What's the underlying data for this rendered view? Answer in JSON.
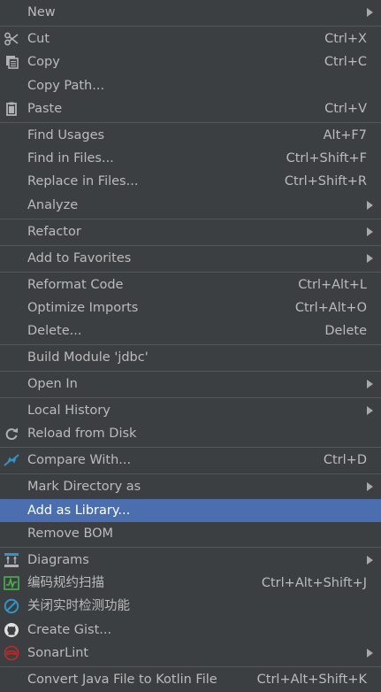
{
  "menu": {
    "new": {
      "label": "New"
    },
    "cut": {
      "label": "Cut",
      "shortcut": "Ctrl+X",
      "icon": "scissors-icon"
    },
    "copy": {
      "label": "Copy",
      "shortcut": "Ctrl+C",
      "icon": "copy-icon"
    },
    "copy_path": {
      "label": "Copy Path..."
    },
    "paste": {
      "label": "Paste",
      "shortcut": "Ctrl+V",
      "icon": "clipboard-icon"
    },
    "find_usages": {
      "label": "Find Usages",
      "shortcut": "Alt+F7"
    },
    "find_in_files": {
      "label": "Find in Files...",
      "shortcut": "Ctrl+Shift+F"
    },
    "replace_in_files": {
      "label": "Replace in Files...",
      "shortcut": "Ctrl+Shift+R"
    },
    "analyze": {
      "label": "Analyze"
    },
    "refactor": {
      "label": "Refactor"
    },
    "add_to_favorites": {
      "label": "Add to Favorites"
    },
    "reformat_code": {
      "label": "Reformat Code",
      "shortcut": "Ctrl+Alt+L"
    },
    "optimize_imports": {
      "label": "Optimize Imports",
      "shortcut": "Ctrl+Alt+O"
    },
    "delete": {
      "label": "Delete...",
      "shortcut": "Delete"
    },
    "build_module": {
      "label": "Build Module 'jdbc'"
    },
    "open_in": {
      "label": "Open In"
    },
    "local_history": {
      "label": "Local History"
    },
    "reload_from_disk": {
      "label": "Reload from Disk",
      "icon": "reload-icon"
    },
    "compare_with": {
      "label": "Compare With...",
      "shortcut": "Ctrl+D",
      "icon": "compare-arrows-icon"
    },
    "mark_directory_as": {
      "label": "Mark Directory as"
    },
    "add_as_library": {
      "label": "Add as Library..."
    },
    "remove_bom": {
      "label": "Remove BOM"
    },
    "diagrams": {
      "label": "Diagrams",
      "icon": "diagram-icon"
    },
    "code_scan": {
      "label": "编码规约扫描",
      "shortcut": "Ctrl+Alt+Shift+J",
      "icon": "scan-chart-icon"
    },
    "close_realtime_check": {
      "label": "关闭实时检测功能",
      "icon": "block-circle-icon"
    },
    "create_gist": {
      "label": "Create Gist...",
      "icon": "github-icon"
    },
    "sonarlint": {
      "label": "SonarLint",
      "icon": "sonarlint-icon"
    },
    "convert_kotlin": {
      "label": "Convert Java File to Kotlin File",
      "shortcut": "Ctrl+Alt+Shift+K"
    }
  },
  "colors": {
    "background": "#3c3f41",
    "selected": "#4b6eaf",
    "separator": "#545658",
    "text": "#bbbbbb"
  }
}
